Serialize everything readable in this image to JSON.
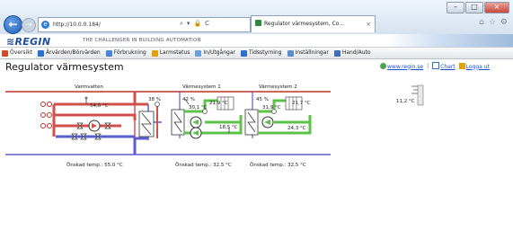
{
  "browser": {
    "url": "http://10.0.0.184/",
    "tab_title": "Regulator värmesystem, Co...",
    "tab_close": "×",
    "addr_icons": [
      "⌕",
      "▾",
      "🔒",
      "C"
    ],
    "window_buttons": [
      "–",
      "□",
      "×"
    ],
    "toolbar_icons": [
      "⌂",
      "☆",
      "⚙"
    ]
  },
  "header": {
    "logo": "≋REGIN",
    "tagline": "THE CHALLENGER IN BUILDING AUTOMATION"
  },
  "nav": [
    {
      "label": "Översikt",
      "icon": "overview-icon",
      "color": "#d34a2a"
    },
    {
      "label": "Ärvärden/Börvärden",
      "icon": "values-icon",
      "color": "#2f6fd0"
    },
    {
      "label": "Förbrukning",
      "icon": "consumption-icon",
      "color": "#2f6fd0"
    },
    {
      "label": "Larmstatus",
      "icon": "alarm-icon",
      "color": "#e0a200"
    },
    {
      "label": "In/Utgångar",
      "icon": "io-icon",
      "color": "#2f6fd0"
    },
    {
      "label": "Tidsstyrning",
      "icon": "schedule-icon",
      "color": "#2f6fd0"
    },
    {
      "label": "Inställningar",
      "icon": "settings-icon",
      "color": "#2f6fd0"
    },
    {
      "label": "Hand/Auto",
      "icon": "hand-auto-icon",
      "color": "#2f6fd0"
    }
  ],
  "page": {
    "title": "Regulator värmesystem",
    "links": {
      "website": "www.regin.se",
      "chart": "Chart",
      "logout": "Logga ut",
      "separator": "|"
    }
  },
  "diagram": {
    "sections": {
      "varmvatten": "Varmvatten",
      "vs1": "Värmesystem 1",
      "vs2": "Värmesystem 2"
    },
    "outdoor_temp": "11,2 °C",
    "varmvatten": {
      "supply_temp": "54,6 °C",
      "valve": "38 %",
      "setpoint": "Önskad temp.: 55,0 °C"
    },
    "vs1": {
      "valve": "42 %",
      "supply_temp": "30,1 °C",
      "room_temp": "21,9 °C",
      "return_temp": "18,5 °C",
      "setpoint": "Önskad temp.: 32,5 °C"
    },
    "vs2": {
      "valve": "45 %",
      "supply_temp": "31,9 °C",
      "room_temp": "21,7 °C",
      "return_temp": "24,3 °C",
      "setpoint": "Önskad temp.: 32,5 °C"
    },
    "colors": {
      "hot": "#d2504a",
      "cold": "#5a5fcf",
      "heating": "#5cc24a",
      "header_line": "#c0302a"
    }
  }
}
